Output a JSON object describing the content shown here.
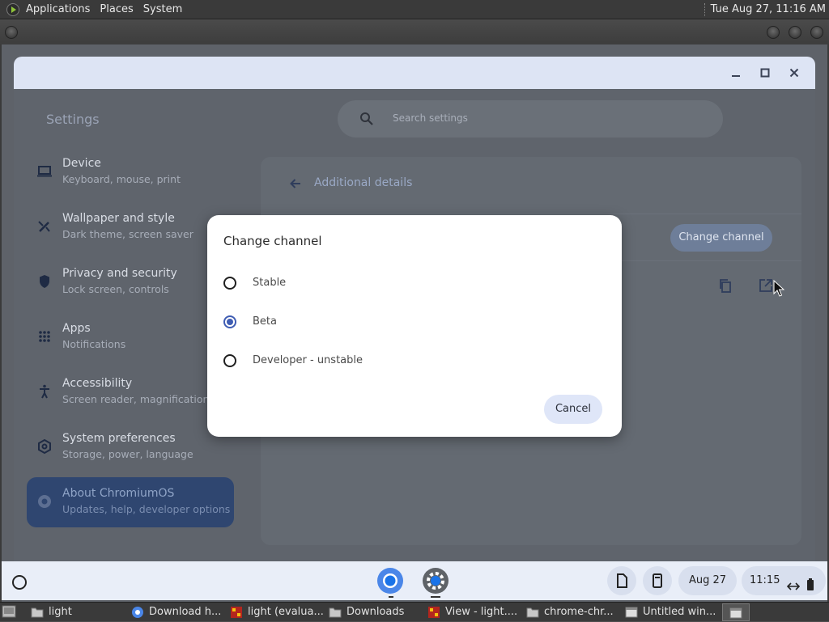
{
  "top_panel": {
    "menus": [
      "Applications",
      "Places",
      "System"
    ],
    "clock": "Tue Aug 27, 11:16 AM"
  },
  "settings": {
    "title": "Settings",
    "search_placeholder": "Search settings",
    "nav": [
      {
        "title": "Device",
        "sub": "Keyboard, mouse, print",
        "icon": "laptop-icon"
      },
      {
        "title": "Wallpaper and style",
        "sub": "Dark theme, screen saver",
        "icon": "paintbrush-icon"
      },
      {
        "title": "Privacy and security",
        "sub": "Lock screen, controls",
        "icon": "shield-icon"
      },
      {
        "title": "Apps",
        "sub": "Notifications",
        "icon": "apps-grid-icon"
      },
      {
        "title": "Accessibility",
        "sub": "Screen reader, magnification",
        "icon": "accessibility-icon"
      },
      {
        "title": "System preferences",
        "sub": "Storage, power, language",
        "icon": "system-gear-icon"
      },
      {
        "title": "About ChromiumOS",
        "sub": "Updates, help, developer options",
        "icon": "chromium-icon"
      }
    ],
    "page": {
      "title": "Additional details",
      "change_channel_label": "Change channel"
    }
  },
  "dialog": {
    "title": "Change channel",
    "options": [
      {
        "label": "Stable",
        "checked": false
      },
      {
        "label": "Beta",
        "checked": true
      },
      {
        "label": "Developer - unstable",
        "checked": false
      }
    ],
    "cancel_label": "Cancel"
  },
  "shelf": {
    "date": "Aug 27",
    "time": "11:15"
  },
  "taskbar": {
    "tasks": [
      {
        "label": "light",
        "icon": "folder-icon"
      },
      {
        "label": "Download h...",
        "icon": "chrome-icon"
      },
      {
        "label": "light (evalua...",
        "icon": "terminal-icon"
      },
      {
        "label": "Downloads",
        "icon": "folder-icon"
      },
      {
        "label": "View - light....",
        "icon": "terminal-icon"
      },
      {
        "label": "chrome-chr...",
        "icon": "folder-icon"
      },
      {
        "label": "Untitled win...",
        "icon": "window-icon"
      }
    ]
  },
  "colors": {
    "accent": "#3f5db3",
    "active_nav": "#2f4670",
    "scrim": "#5f646c"
  }
}
